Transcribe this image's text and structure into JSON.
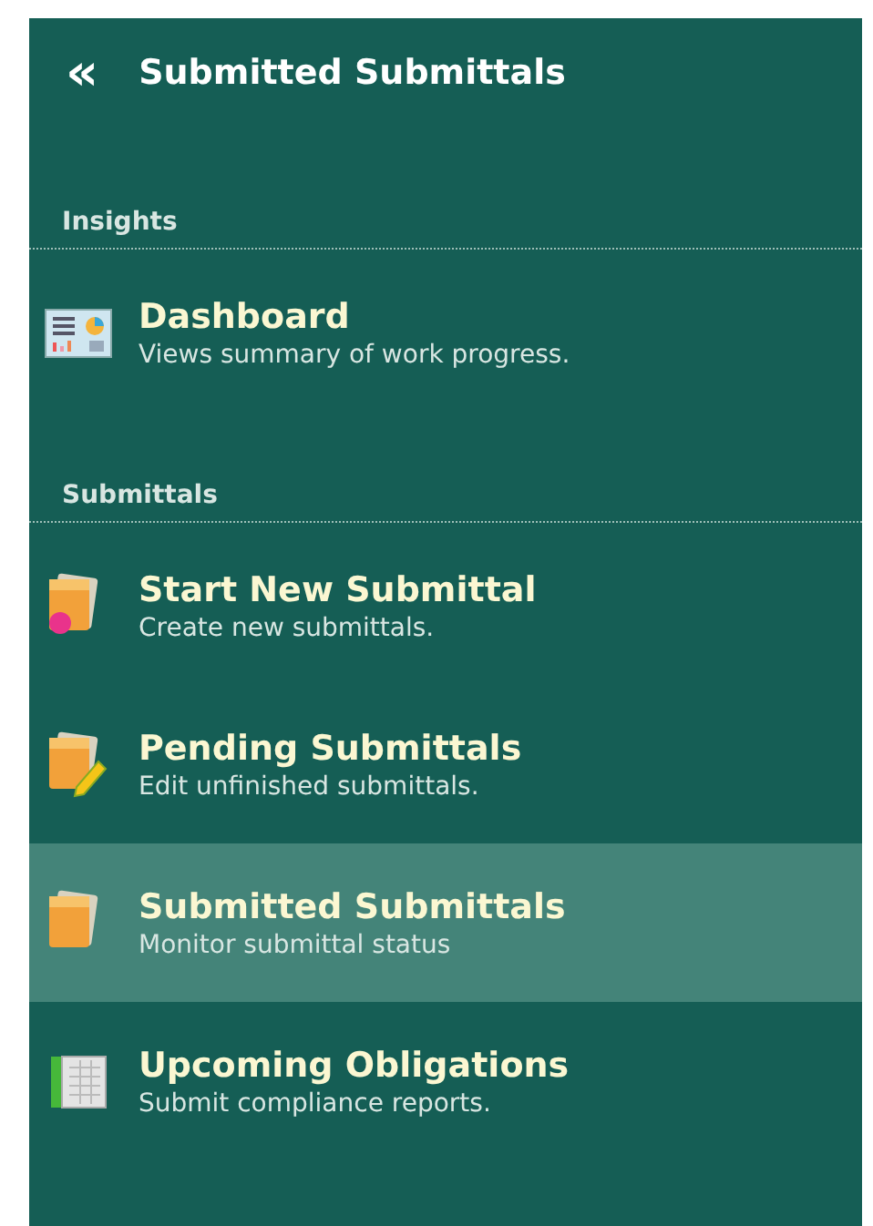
{
  "header": {
    "back_glyph": "«",
    "title": "Submitted Submittals"
  },
  "sections": [
    {
      "heading": "Insights",
      "items": [
        {
          "kind": "dashboard",
          "title": "Dashboard",
          "description": "Views summary of work progress.",
          "selected": false
        }
      ]
    },
    {
      "heading": "Submittals",
      "items": [
        {
          "kind": "new",
          "title": "Start New Submittal",
          "description": "Create new submittals.",
          "selected": false
        },
        {
          "kind": "edit",
          "title": "Pending Submittals",
          "description": "Edit unfinished submittals.",
          "selected": false
        },
        {
          "kind": "folder",
          "title": "Submitted Submittals",
          "description": "Monitor submittal status",
          "selected": true
        },
        {
          "kind": "ledger",
          "title": "Upcoming Obligations",
          "description": "Submit compliance reports.",
          "selected": false
        }
      ]
    }
  ]
}
